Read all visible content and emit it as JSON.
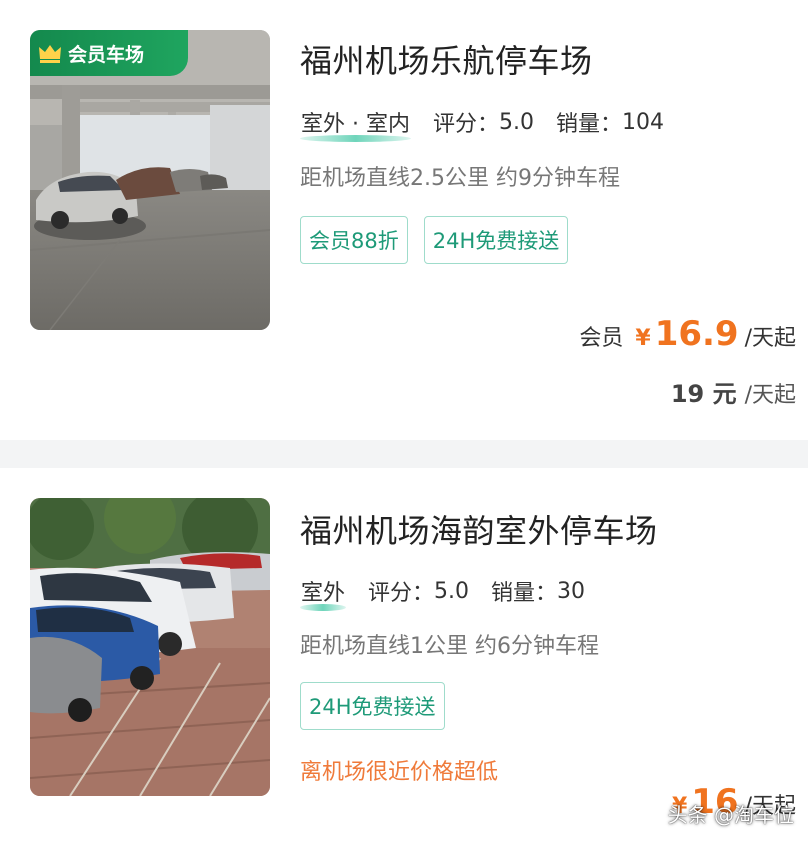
{
  "colors": {
    "brand_green": "#1a9a58",
    "tag_text": "#1e9a78",
    "tag_border": "#9fdccb",
    "price_orange": "#f0731f",
    "promo_orange": "#ef7a3a"
  },
  "listings": [
    {
      "badge_label": "会员车场",
      "badge_icon": "crown-icon",
      "title": "福州机场乐航停车场",
      "environment": "室外 · 室内",
      "rating_label": "评分：",
      "rating_value": "5.0",
      "sales_label": "销量：",
      "sales_value": "104",
      "distance": "距机场直线2.5公里 约9分钟车程",
      "tags": [
        "会员88折",
        "24H免费接送"
      ],
      "member_price_label": "会员",
      "currency_symbol": "¥",
      "member_price": "16.9",
      "price_unit": "/天起",
      "normal_price": "19 元",
      "normal_price_unit": "/天起"
    },
    {
      "title": "福州机场海韵室外停车场",
      "environment": "室外",
      "rating_label": "评分：",
      "rating_value": "5.0",
      "sales_label": "销量：",
      "sales_value": "30",
      "distance": "距机场直线1公里 约6分钟车程",
      "tags": [
        "24H免费接送"
      ],
      "promo": "离机场很近价格超低",
      "currency_symbol": "¥",
      "price": "16",
      "price_unit": "/天起"
    }
  ],
  "watermark": "头条 @淘车位"
}
